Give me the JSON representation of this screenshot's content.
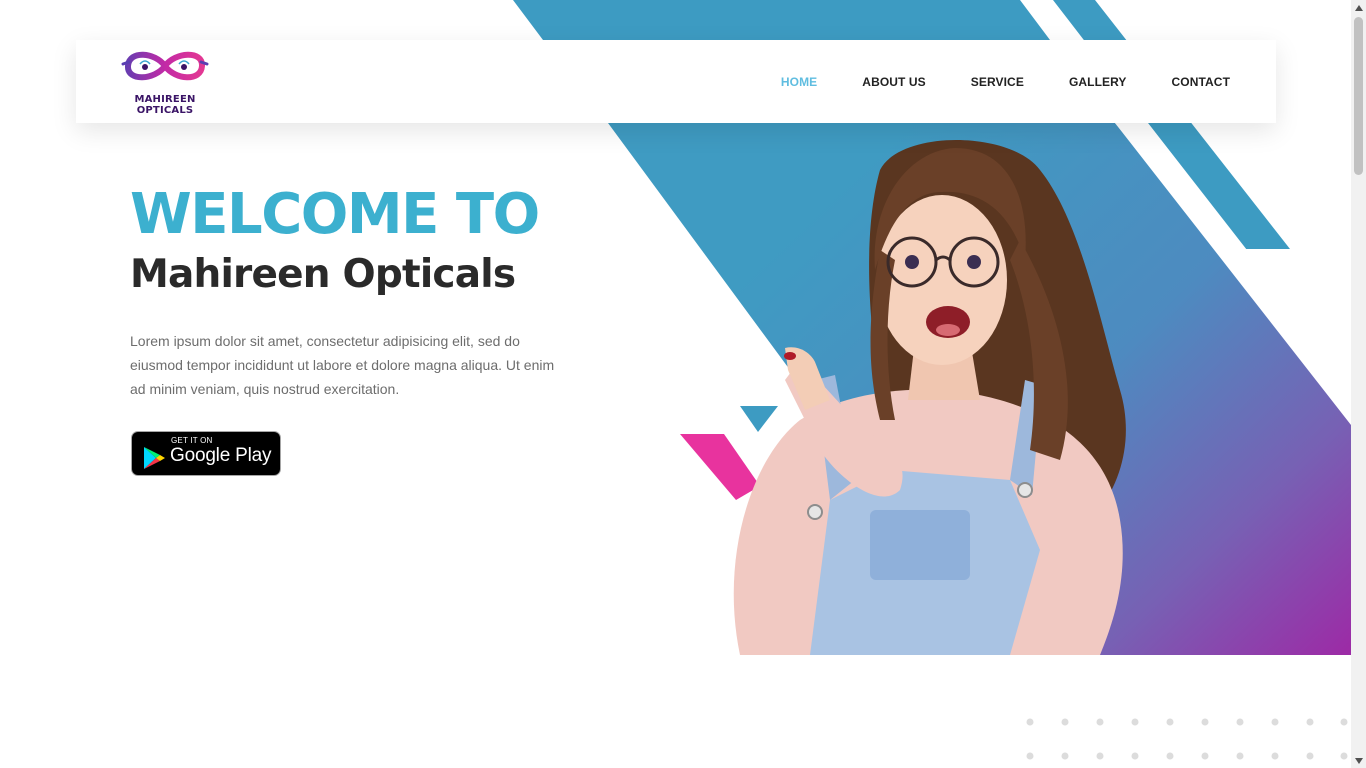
{
  "brand": {
    "logo_line1": "MAHIREEN",
    "logo_line2": "OPTICALS",
    "colors": {
      "primary": "#3cb0cf",
      "accent_pink": "#e0309c",
      "gradient_end": "#9a2aa5",
      "dark": "#2a2a2a"
    }
  },
  "nav": {
    "items": [
      {
        "label": "HOME",
        "active": true
      },
      {
        "label": "ABOUT US",
        "active": false
      },
      {
        "label": "SERVICE",
        "active": false
      },
      {
        "label": "GALLERY",
        "active": false
      },
      {
        "label": "CONTACT",
        "active": false
      }
    ]
  },
  "hero": {
    "title_line1": "WELCOME TO",
    "title_line2": "Mahireen Opticals",
    "description": "Lorem ipsum dolor sit amet, consectetur adipisicing elit, sed do eiusmod tempor incididunt ut labore et dolore magna aliqua. Ut enim ad minim veniam, quis nostrud exercitation.",
    "store_badge": {
      "small_text": "GET IT ON",
      "big_text": "Google Play",
      "icon": "google-play-icon"
    },
    "image": "woman-with-glasses-pointing"
  },
  "icons": {
    "logo": "infinity-glasses-logo-icon",
    "scroll_up": "triangle-up-icon",
    "scroll_down": "triangle-down-icon"
  }
}
